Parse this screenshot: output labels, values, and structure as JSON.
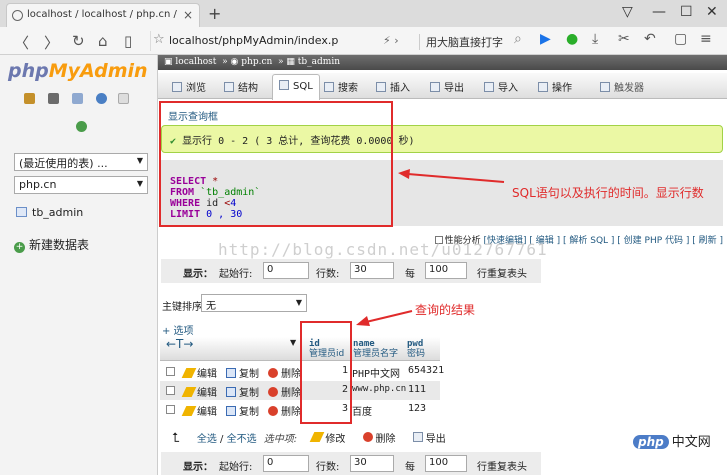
{
  "browser": {
    "tab_title": "localhost / localhost / php.cn / tb",
    "url": "localhost/phpMyAdmin/index.p",
    "addr_hint": "用大脑直接打字",
    "win": [
      "▽",
      "—",
      "☐",
      "✕"
    ]
  },
  "sidebar": {
    "logo_a": "php",
    "logo_b": "MyAdmin",
    "recent": "(最近使用的表) ...",
    "database": "php.cn",
    "table": "tb_admin",
    "new_db": "新建数据表"
  },
  "breadcrumb": {
    "server": "localhost",
    "db": "php.cn",
    "table": "tb_admin"
  },
  "menu": [
    "浏览",
    "结构",
    "SQL",
    "搜索",
    "插入",
    "导出",
    "导入",
    "操作",
    "触发器"
  ],
  "query_box": {
    "title": "显示查询框",
    "success": "显示行 0 - 2 ( 3 总计, 查询花费 0.0000 秒)",
    "select_kw": "SELECT",
    "star": "*",
    "from_kw": "FROM",
    "from_tbl": "`tb_admin`",
    "where_kw": "WHERE",
    "where_col": "id",
    "where_op": "<",
    "where_val": "4",
    "limit_kw": "LIMIT",
    "limit_vals": "0 , 30"
  },
  "annotations": {
    "sql_note": "SQL语句以及执行的时间。显示行数",
    "result_note": "查询的结果"
  },
  "profiling": {
    "label": "性能分析",
    "links": "[快速编辑] [ 编辑 ] [ 解析 SQL ] [ 创建 PHP 代码 ] [ 刷新 ]"
  },
  "watermark": "http://blog.csdn.net/u012767761",
  "pager": {
    "show": "显示：",
    "start_lbl": "起始行:",
    "start": "0",
    "rows_lbl": "行数:",
    "rows": "30",
    "every": "每",
    "every_val": "100",
    "repeat": "行重复表头"
  },
  "sort": {
    "label": "主键排序：",
    "value": "无"
  },
  "options": "+ 选项",
  "columns": [
    {
      "name": "id",
      "comment": "管理员id"
    },
    {
      "name": "name",
      "comment": "管理员名字"
    },
    {
      "name": "pwd",
      "comment": "密码"
    }
  ],
  "row_actions": {
    "edit": "编辑",
    "copy": "复制",
    "del": "删除"
  },
  "rows": [
    {
      "id": "1",
      "name": "PHP中文网",
      "pwd": "654321"
    },
    {
      "id": "2",
      "name": "www.php.cn",
      "pwd": "111"
    },
    {
      "id": "3",
      "name": "百度",
      "pwd": "123"
    }
  ],
  "bulk": {
    "all": "全选",
    "sep": " / ",
    "none": "全不选",
    "selected": "选中项:",
    "edit": "修改",
    "del": "删除",
    "export": "导出"
  },
  "brand": {
    "php": "php",
    "cn": "中文网"
  },
  "colors": {
    "red": "#e02b2b",
    "link": "#235a81",
    "success_bg": "#ebf8a4"
  }
}
